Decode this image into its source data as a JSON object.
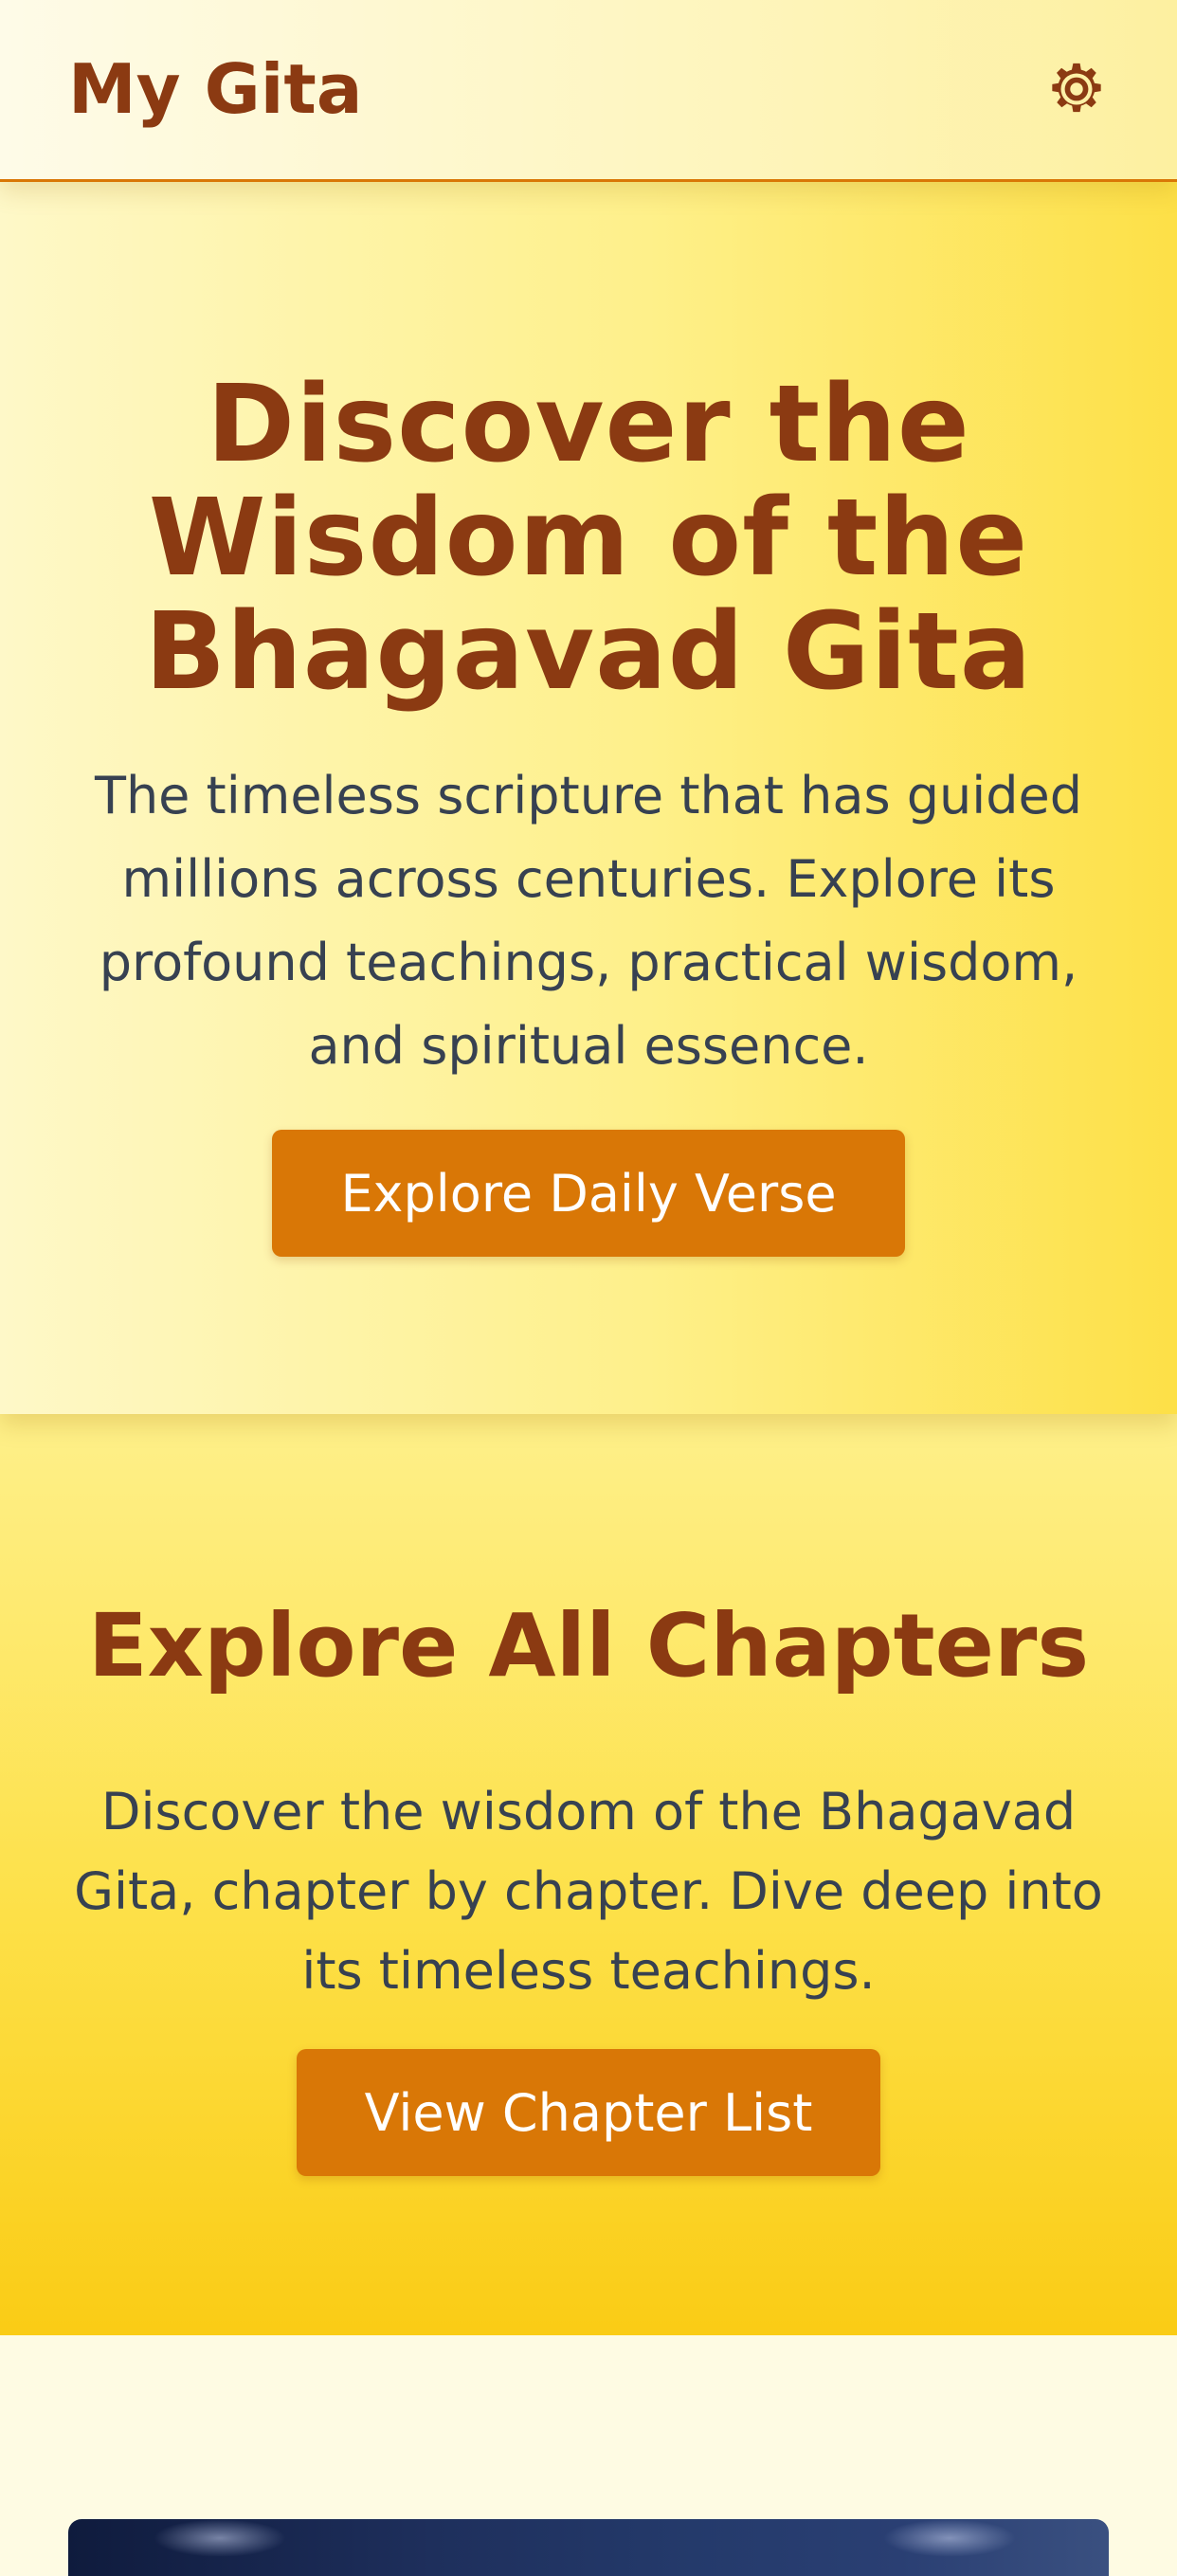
{
  "header": {
    "app_title": "My Gita",
    "settings_icon": "gear-icon"
  },
  "hero": {
    "title": "Discover the Wisdom of the Bhagavad Gita",
    "subtitle": "The timeless scripture that has guided millions across centuries. Explore its profound teachings, practical wisdom, and spiritual essence.",
    "button_label": "Explore Daily Verse"
  },
  "chapters": {
    "title": "Explore All Chapters",
    "description": "Discover the wisdom of the Bhagavad Gita, chapter by chapter. Dive deep into its timeless teachings.",
    "button_label": "View Chapter List"
  },
  "colors": {
    "brand_brown": "#8b3a12",
    "accent_orange": "#d97706",
    "body_text": "#374151",
    "yellow_light": "#fef08a",
    "yellow_strong": "#facc15",
    "cream": "#fefbe3"
  }
}
